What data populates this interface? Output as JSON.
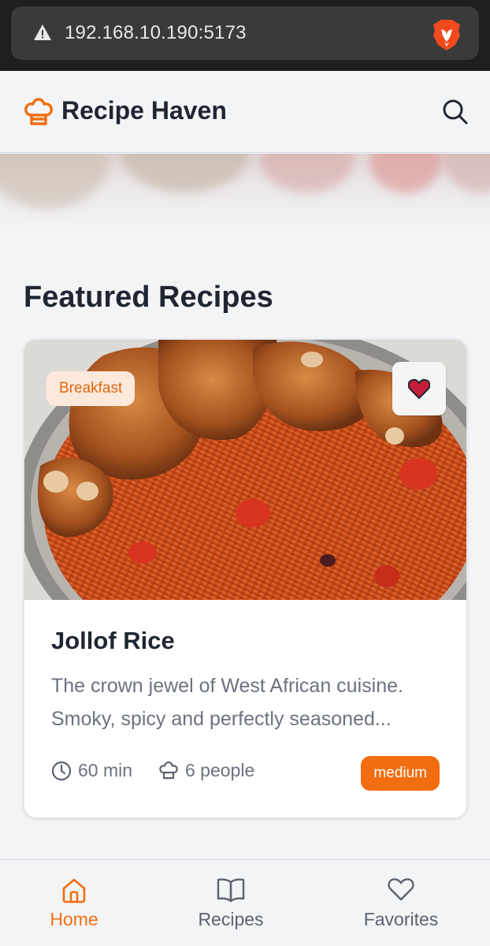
{
  "browser": {
    "url": "192.168.10.190:5173",
    "warning_icon": "warning-triangle-icon",
    "brave_icon": "brave-lion-icon"
  },
  "header": {
    "title": "Recipe Haven",
    "logo_icon": "chef-hat-icon",
    "search_icon": "search-icon"
  },
  "main": {
    "section_title": "Featured Recipes",
    "recipe": {
      "category": "Breakfast",
      "title": "Jollof Rice",
      "description": "The crown jewel of West African cuisine. Smoky, spicy and perfectly seasoned...",
      "time": "60 min",
      "servings": "6 people",
      "difficulty": "medium",
      "favorited": true
    }
  },
  "bottom_nav": {
    "items": [
      {
        "label": "Home",
        "icon": "home-icon",
        "active": true
      },
      {
        "label": "Recipes",
        "icon": "book-icon",
        "active": false
      },
      {
        "label": "Favorites",
        "icon": "heart-icon",
        "active": false
      }
    ]
  },
  "colors": {
    "accent": "#f26d0f",
    "text_dark": "#1f2633",
    "text_muted": "#6b7280",
    "favorite": "#c41e3a"
  }
}
